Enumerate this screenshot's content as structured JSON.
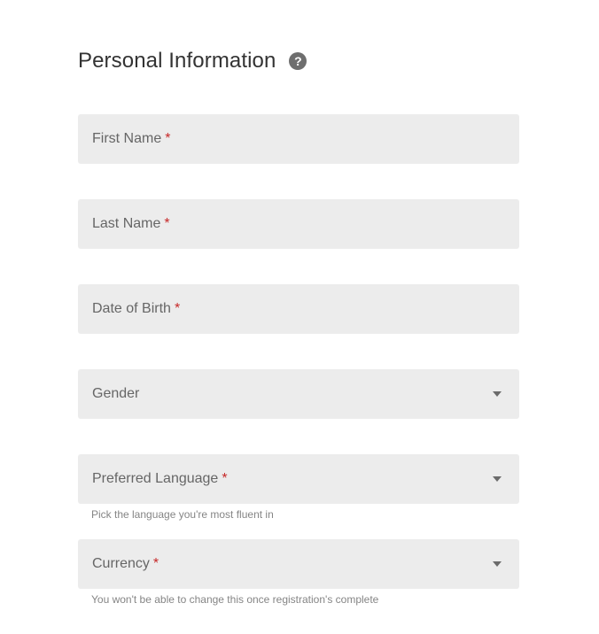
{
  "section": {
    "title": "Personal Information",
    "help_icon": "help-circle-icon",
    "help_glyph": "?"
  },
  "fields": {
    "first_name": {
      "label": "First Name",
      "required_mark": "*"
    },
    "last_name": {
      "label": "Last Name",
      "required_mark": "*"
    },
    "date_of_birth": {
      "label": "Date of Birth",
      "required_mark": "*"
    },
    "gender": {
      "label": "Gender",
      "icon": "dropdown-arrow-icon"
    },
    "preferred_language": {
      "label": "Preferred Language",
      "required_mark": "*",
      "icon": "dropdown-arrow-icon",
      "helper": "Pick the language you're most fluent in"
    },
    "currency": {
      "label": "Currency",
      "required_mark": "*",
      "icon": "dropdown-arrow-icon",
      "helper": "You won't be able to change this once registration's complete"
    }
  },
  "colors": {
    "field_background": "#ececec",
    "required_mark": "#c62828",
    "label_text": "#666666",
    "title_text": "#333333",
    "helper_text": "#858585"
  }
}
